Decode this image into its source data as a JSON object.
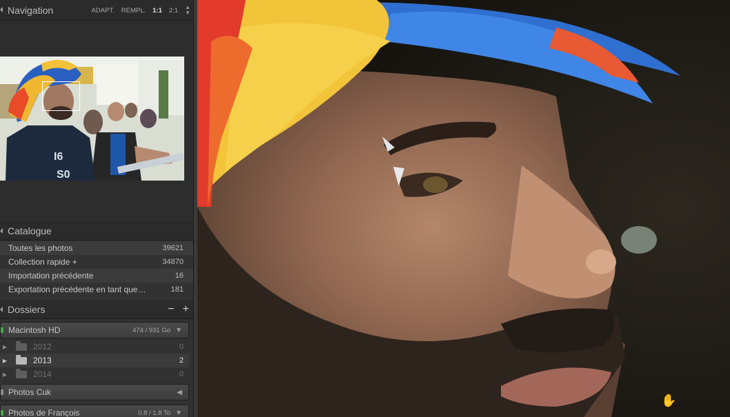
{
  "navigator": {
    "title": "Navigation",
    "zoom_options": [
      "ADAPT.",
      "REMPL.",
      "1:1",
      "2:1"
    ],
    "active_zoom": "1:1"
  },
  "catalogue": {
    "title": "Catalogue",
    "items": [
      {
        "label": "Toutes les photos",
        "count": "39621"
      },
      {
        "label": "Collection rapide +",
        "count": "34870"
      },
      {
        "label": "Importation précédente",
        "count": "16"
      },
      {
        "label": "Exportation précédente en tant que…",
        "count": "181"
      }
    ]
  },
  "dossiers": {
    "title": "Dossiers",
    "minus": "−",
    "plus": "+",
    "volumes": [
      {
        "name": "Macintosh HD",
        "size": "474 / 931 Go",
        "arrow": "▼"
      },
      {
        "name": "Photos Cuk",
        "size": "",
        "arrow": "◀"
      },
      {
        "name": "Photos de François",
        "size": "0.8 / 1.8 To",
        "arrow": "▼"
      }
    ],
    "folders": [
      {
        "name": "2012",
        "count": "0"
      },
      {
        "name": "2013",
        "count": "2"
      },
      {
        "name": "2014",
        "count": "0"
      }
    ]
  },
  "colors": {
    "panel_bg": "#323232",
    "header_bg": "#2b2b2b",
    "volume_led": "#4aa84a"
  },
  "icons": {
    "cursor": "hand-cursor-icon",
    "folder": "folder-icon"
  }
}
